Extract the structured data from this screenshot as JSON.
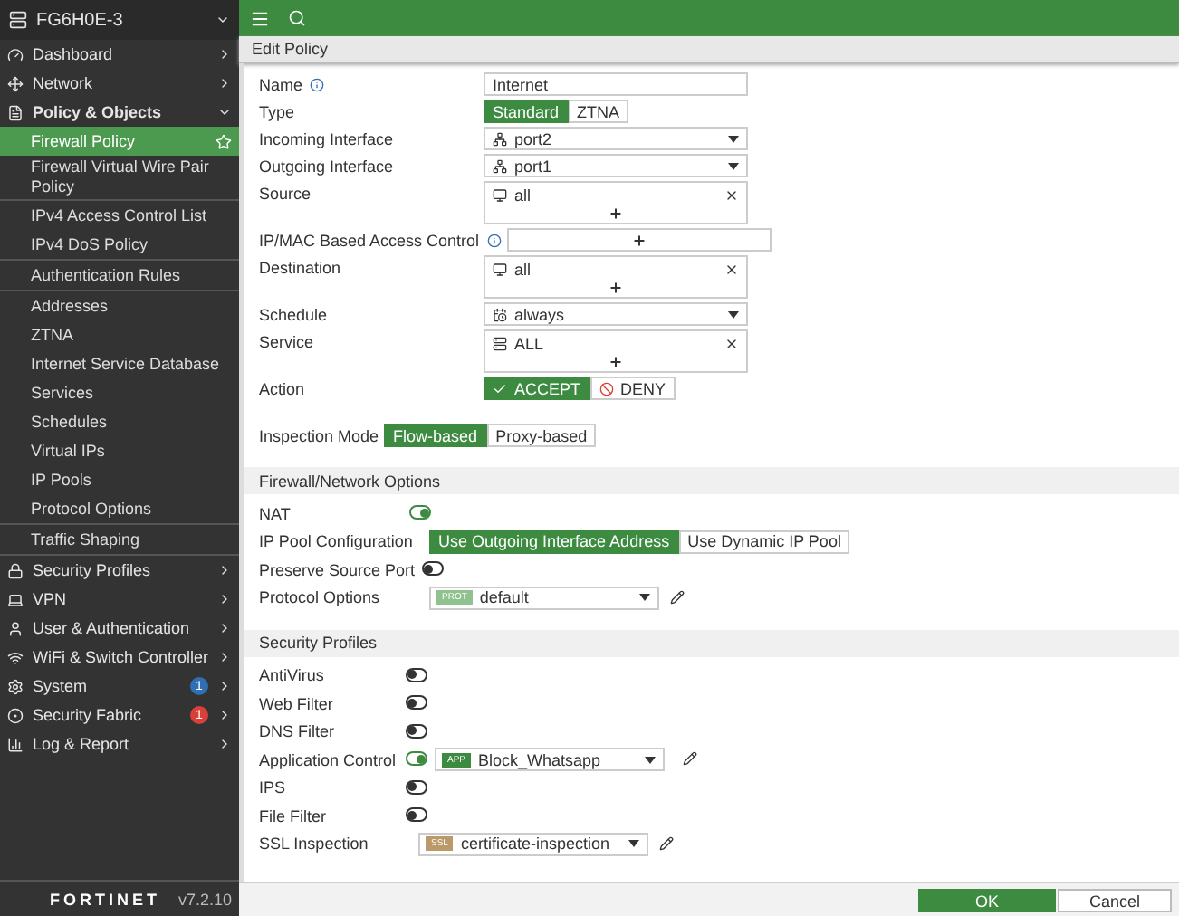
{
  "sidebar": {
    "device": "FG6H0E-3",
    "groups": [
      {
        "label": "Dashboard",
        "expanded": false
      },
      {
        "label": "Network",
        "expanded": false
      },
      {
        "label": "Policy & Objects",
        "expanded": true,
        "sections": [
          [
            {
              "label": "Firewall Policy",
              "selected": true,
              "favorite": true
            },
            {
              "label": "Firewall Virtual Wire Pair Policy",
              "selected": false,
              "favorite": false
            }
          ],
          [
            {
              "label": "IPv4 Access Control List",
              "selected": false,
              "favorite": false
            },
            {
              "label": "IPv4 DoS Policy",
              "selected": false,
              "favorite": false
            }
          ],
          [
            {
              "label": "Authentication Rules",
              "selected": false,
              "favorite": false
            }
          ],
          [
            {
              "label": "Addresses",
              "selected": false,
              "favorite": false
            },
            {
              "label": "ZTNA",
              "selected": false,
              "favorite": false
            },
            {
              "label": "Internet Service Database",
              "selected": false,
              "favorite": false
            },
            {
              "label": "Services",
              "selected": false,
              "favorite": false
            },
            {
              "label": "Schedules",
              "selected": false,
              "favorite": false
            },
            {
              "label": "Virtual IPs",
              "selected": false,
              "favorite": false
            },
            {
              "label": "IP Pools",
              "selected": false,
              "favorite": false
            },
            {
              "label": "Protocol Options",
              "selected": false,
              "favorite": false
            }
          ],
          [
            {
              "label": "Traffic Shaping",
              "selected": false,
              "favorite": false
            }
          ]
        ]
      },
      {
        "label": "Security Profiles",
        "expanded": false
      },
      {
        "label": "VPN",
        "expanded": false
      },
      {
        "label": "User & Authentication",
        "expanded": false
      },
      {
        "label": "WiFi & Switch Controller",
        "expanded": false
      },
      {
        "label": "System",
        "expanded": false,
        "badge": "1",
        "color": "#2f6fb3"
      },
      {
        "label": "Security Fabric",
        "expanded": false,
        "badge": "1",
        "color": "#d9403a"
      },
      {
        "label": "Log & Report",
        "expanded": false
      }
    ],
    "logo": "FORTINET",
    "version": "v7.2.10"
  },
  "page_title": "Edit Policy",
  "policy": [
    {
      "kind": "input",
      "label": "Name",
      "info": true,
      "value": "Internet"
    },
    {
      "kind": "segmented",
      "label": "Type",
      "options": [
        {
          "label": "Standard",
          "selected": true
        },
        {
          "label": "ZTNA",
          "selected": false
        }
      ]
    },
    {
      "kind": "select",
      "label": "Incoming Interface",
      "value": "port2"
    },
    {
      "kind": "select",
      "label": "Outgoing Interface",
      "value": "port1"
    },
    {
      "kind": "multi",
      "label": "Source",
      "values": [
        "all"
      ]
    },
    {
      "kind": "multi",
      "label": "IP/MAC Based Access Control",
      "info": true
    },
    {
      "kind": "multi",
      "label": "Destination",
      "values": [
        "all"
      ]
    },
    {
      "kind": "select",
      "label": "Schedule",
      "value": "always"
    },
    {
      "kind": "multi",
      "label": "Service",
      "values": [
        "ALL"
      ]
    },
    {
      "kind": "action",
      "label": "Action",
      "options": [
        {
          "label": "ACCEPT",
          "selected": true
        },
        {
          "label": "DENY",
          "selected": false
        }
      ]
    },
    {
      "kind": "inline",
      "label": "Inspection Mode",
      "options": [
        {
          "label": "Flow-based",
          "selected": true
        },
        {
          "label": "Proxy-based",
          "selected": false
        }
      ]
    }
  ],
  "sections": [
    {
      "title": "Firewall/Network Options",
      "rows": [
        {
          "kind": "toggle",
          "label": "NAT",
          "on": true
        },
        {
          "kind": "segmented",
          "label": "IP Pool Configuration",
          "options": [
            {
              "label": "Use Outgoing Interface Address",
              "selected": true
            },
            {
              "label": "Use Dynamic IP Pool",
              "selected": false
            }
          ]
        },
        {
          "kind": "toggle",
          "label": "Preserve Source Port",
          "on": false
        },
        {
          "kind": "profile",
          "label": "Protocol Options",
          "tag": "PROT",
          "color": "#8fc28f",
          "value": "default"
        }
      ]
    },
    {
      "title": "Security Profiles",
      "rows": [
        {
          "kind": "toggle",
          "label": "AntiVirus",
          "on": false
        },
        {
          "kind": "toggle",
          "label": "Web Filter",
          "on": false
        },
        {
          "kind": "toggle",
          "label": "DNS Filter",
          "on": false
        },
        {
          "kind": "toggle",
          "label": "Application Control",
          "on": true,
          "tag": "APP",
          "color": "#3d8b40",
          "value": "Block_Whatsapp"
        },
        {
          "kind": "toggle",
          "label": "IPS",
          "on": false
        },
        {
          "kind": "toggle",
          "label": "File Filter",
          "on": false
        },
        {
          "kind": "profile",
          "label": "SSL Inspection",
          "tag": "SSL",
          "color": "#b99a68",
          "value": "certificate-inspection"
        }
      ]
    }
  ],
  "buttons": [
    {
      "label": "OK",
      "kind": "primary"
    },
    {
      "label": "Cancel",
      "kind": "secondary"
    }
  ]
}
